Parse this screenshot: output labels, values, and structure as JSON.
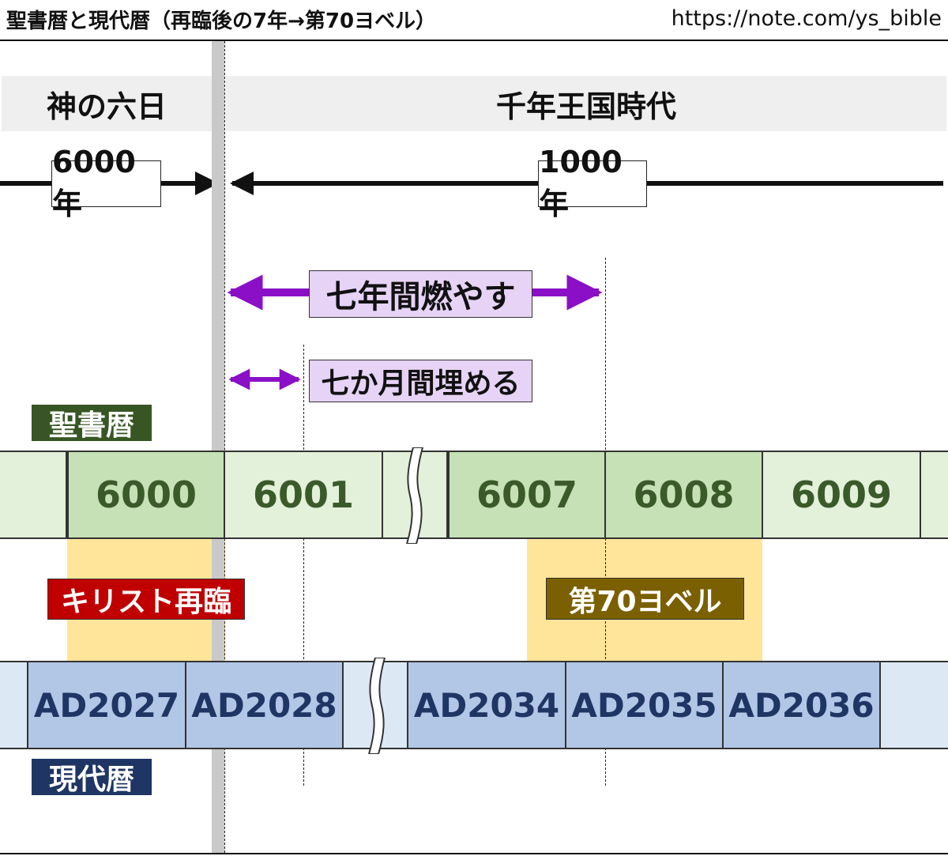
{
  "header": {
    "title": "聖書暦と現代暦（再臨後の7年→第70ヨベル）",
    "url": "https://note.com/ys_bible"
  },
  "eras": {
    "left": "神の六日",
    "right": "千年王国時代"
  },
  "spans": {
    "left_years": "6000年",
    "right_years": "1000年",
    "burn": "七年間燃やす",
    "bury": "七か月間埋める"
  },
  "labels": {
    "biblical_calendar": "聖書暦",
    "modern_calendar": "現代暦",
    "second_coming": "キリスト再臨",
    "jubilee": "第70ヨベル"
  },
  "biblical_years": [
    "6000",
    "6001",
    "6007",
    "6008",
    "6009"
  ],
  "modern_years": [
    "AD2027",
    "AD2028",
    "AD2034",
    "AD2035",
    "AD2036"
  ],
  "colors": {
    "green_dark": "#3b5a2a",
    "green_cell": "#c6e1b5",
    "green_cell_light": "#e3f0da",
    "blue_dark": "#1f3564",
    "blue_cell": "#b2c6e6",
    "blue_cell_light": "#dce9f5",
    "purple_arrow": "#8b0fc7",
    "purple_label": "#e6d3f5",
    "red_tag": "#c00000",
    "brown_tag": "#7a6000",
    "yellow_highlight": "#ffe599"
  }
}
